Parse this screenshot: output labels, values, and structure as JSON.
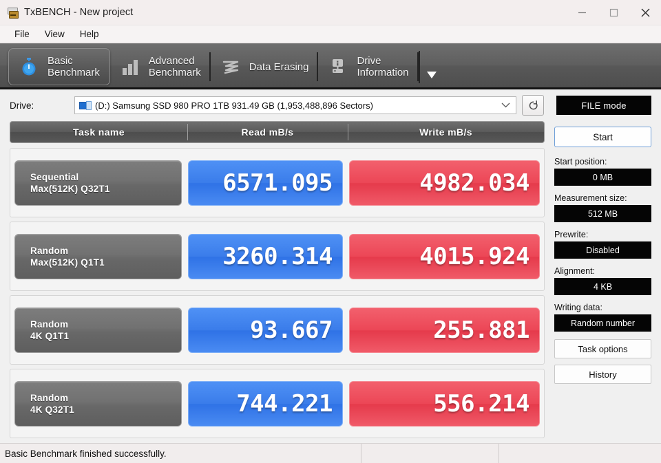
{
  "window": {
    "title": "TxBENCH - New project",
    "app_icon": "disk-drive-icon",
    "controls": {
      "minimize": "minimize-icon",
      "maximize": "maximize-icon",
      "close": "close-icon"
    }
  },
  "menu": {
    "items": [
      {
        "label": "File"
      },
      {
        "label": "View"
      },
      {
        "label": "Help"
      }
    ]
  },
  "tabs": {
    "items": [
      {
        "label": "Basic\nBenchmark",
        "icon": "stopwatch-icon",
        "active": true
      },
      {
        "label": "Advanced\nBenchmark",
        "icon": "bar-chart-icon",
        "active": false
      },
      {
        "label": "Data Erasing",
        "icon": "scribble-erase-icon",
        "active": false
      },
      {
        "label": "Drive\nInformation",
        "icon": "drive-info-icon",
        "active": false
      }
    ],
    "more_icon": "triangle-down-icon"
  },
  "drive": {
    "label": "Drive:",
    "icon": "drive-small-icon",
    "value": "(D:) Samsung SSD 980 PRO 1TB  931.49 GB (1,953,488,896 Sectors)",
    "dropdown_icon": "chevron-down-icon",
    "refresh_icon": "refresh-icon",
    "mode_button": "FILE mode"
  },
  "results": {
    "headers": {
      "task": "Task name",
      "read": "Read mB/s",
      "write": "Write mB/s"
    },
    "rows": [
      {
        "task_line1": "Sequential",
        "task_line2": "Max(512K) Q32T1",
        "read": "6571.095",
        "write": "4982.034"
      },
      {
        "task_line1": "Random",
        "task_line2": "Max(512K) Q1T1",
        "read": "3260.314",
        "write": "4015.924"
      },
      {
        "task_line1": "Random",
        "task_line2": "4K Q1T1",
        "read": "93.667",
        "write": "255.881"
      },
      {
        "task_line1": "Random",
        "task_line2": "4K Q32T1",
        "read": "744.221",
        "write": "556.214"
      }
    ]
  },
  "sidebar": {
    "start_button": "Start",
    "fields": [
      {
        "label": "Start position:",
        "value": "0 MB"
      },
      {
        "label": "Measurement size:",
        "value": "512 MB"
      },
      {
        "label": "Prewrite:",
        "value": "Disabled"
      },
      {
        "label": "Alignment:",
        "value": "4 KB"
      },
      {
        "label": "Writing data:",
        "value": "Random number"
      }
    ],
    "task_options_button": "Task options",
    "history_button": "History"
  },
  "status": {
    "message": "Basic Benchmark finished successfully.",
    "cell2": "",
    "cell3": ""
  },
  "colors": {
    "read_blue": "#3a7cea",
    "write_red": "#ec4656",
    "tab_bar": "#5f5f5f",
    "field_black": "#050505",
    "start_border_blue": "#6f9fd8"
  }
}
